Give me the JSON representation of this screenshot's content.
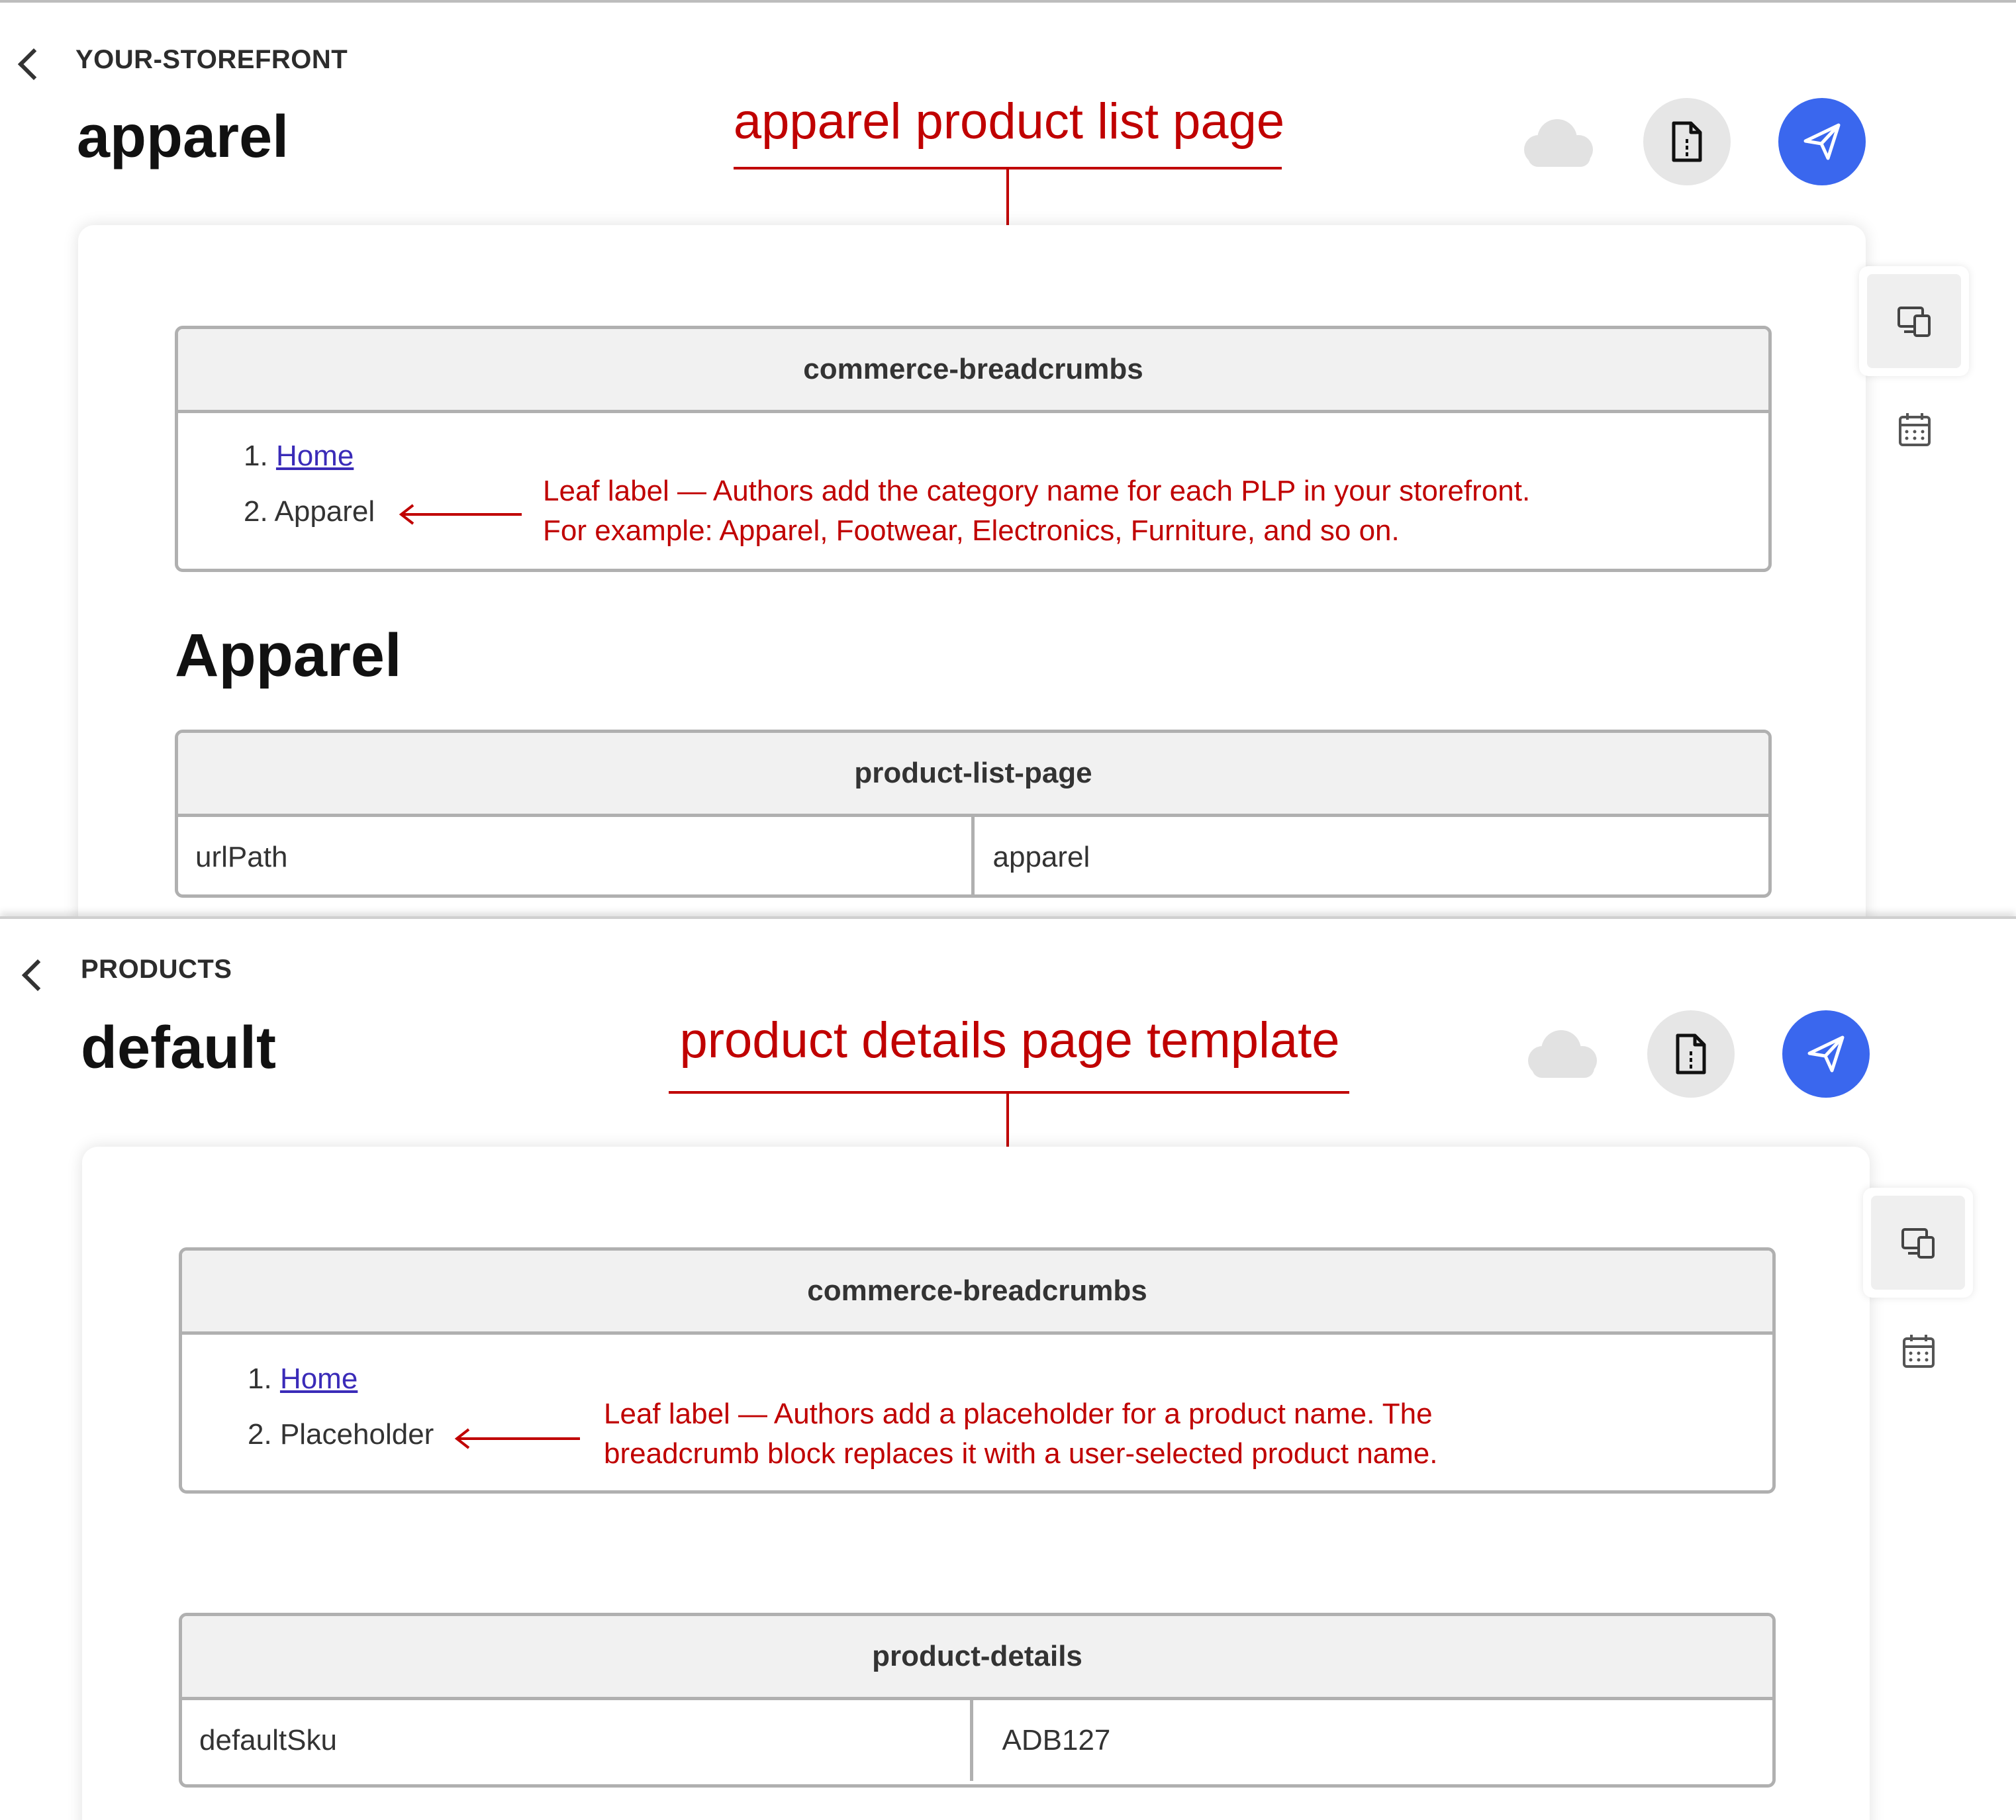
{
  "colors": {
    "annotation": "#c00000",
    "primary_button": "#3a67ee",
    "table_border": "#b0b0b0",
    "table_header_bg": "#f1f1f1",
    "link": "#3a2bb8"
  },
  "top": {
    "breadcrumb": "YOUR-STOREFRONT",
    "title": "apparel",
    "annotation_title": "apparel product list page",
    "breadcrumbs_block": {
      "header": "commerce-breadcrumbs",
      "items": [
        {
          "number": "1.",
          "label": "Home"
        },
        {
          "number": "2.",
          "label": "Apparel"
        }
      ],
      "note_line1": "Leaf label — Authors add the category name for each PLP in your storefront.",
      "note_line2": "For example: Apparel, Footwear, Electronics, Furniture, and so on."
    },
    "heading": "Apparel",
    "content_block": {
      "header": "product-list-page",
      "key": "urlPath",
      "value": "apparel"
    }
  },
  "bottom": {
    "breadcrumb": "PRODUCTS",
    "title": "default",
    "annotation_title": "product details page template",
    "breadcrumbs_block": {
      "header": "commerce-breadcrumbs",
      "items": [
        {
          "number": "1.",
          "label": "Home"
        },
        {
          "number": "2.",
          "label": "Placeholder"
        }
      ],
      "note_line1": "Leaf label — Authors add a placeholder for a product name. The",
      "note_line2": "breadcrumb block replaces it with a user-selected product name."
    },
    "content_block": {
      "header": "product-details",
      "key": "defaultSku",
      "value": "ADB127"
    }
  },
  "icons": [
    "back-chevron-icon",
    "cloud-icon",
    "document-icon",
    "send-icon",
    "device-preview-icon",
    "calendar-icon"
  ]
}
